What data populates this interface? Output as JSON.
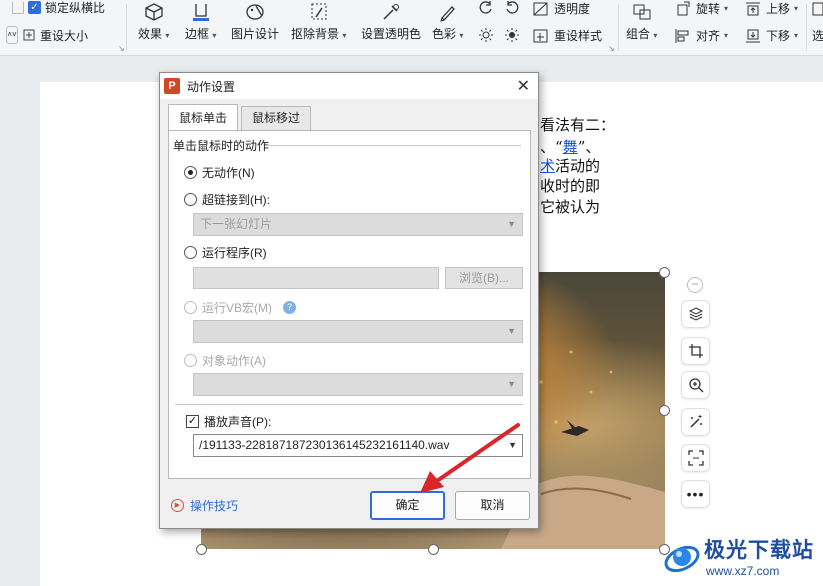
{
  "ribbon": {
    "lock_ratio": "锁定纵横比",
    "reset_size": "重设大小",
    "tools": [
      {
        "id": "effects",
        "label": "效果",
        "caret": true
      },
      {
        "id": "border",
        "label": "边框",
        "caret": true
      },
      {
        "id": "picture_design",
        "label": "图片设计",
        "caret": false
      },
      {
        "id": "remove_bg",
        "label": "抠除背景",
        "caret": true
      },
      {
        "id": "set_transparent",
        "label": "设置透明色",
        "caret": false
      },
      {
        "id": "color",
        "label": "色彩",
        "caret": true
      }
    ],
    "transparency": "透明度",
    "reset_style": "重设样式",
    "group": "组合",
    "rotate": "旋转",
    "align": "对齐",
    "bring_forward": "上移",
    "send_backward": "下移",
    "select_partial": "选"
  },
  "document": {
    "lines": [
      {
        "pre": "看法有二：",
        "link": "",
        "post": ""
      },
      {
        "pre": "、“",
        "link": "舞",
        "post": "”、"
      },
      {
        "pre": "",
        "link": "术",
        "post": "活动的"
      },
      {
        "pre": "收时的即",
        "link": "",
        "post": ""
      },
      {
        "pre": "它被认为",
        "link": "",
        "post": ""
      }
    ]
  },
  "dialog": {
    "title": "动作设置",
    "tabs": [
      "鼠标单击",
      "鼠标移过"
    ],
    "group_title": "单击鼠标时的动作",
    "options": {
      "none": "无动作(N)",
      "hyperlink": "超链接到(H):",
      "hyperlink_value": "下一张幻灯片",
      "run_program": "运行程序(R)",
      "browse": "浏览(B)...",
      "run_macro": "运行VB宏(M)",
      "object_action": "对象动作(A)"
    },
    "selected_option": "none",
    "play_sound_label": "播放声音(P):",
    "play_sound_checked": true,
    "sound_file": "/191133-22818718723013614523216114​0.wav",
    "tips": "操作技巧",
    "ok": "确定",
    "cancel": "取消"
  },
  "watermark": {
    "brand": "极光下载站",
    "url": "www.xz7.com"
  },
  "colors": {
    "accent": "#2f6bd9",
    "arrow": "#d9262b",
    "ppt_icon": "#d24726"
  }
}
